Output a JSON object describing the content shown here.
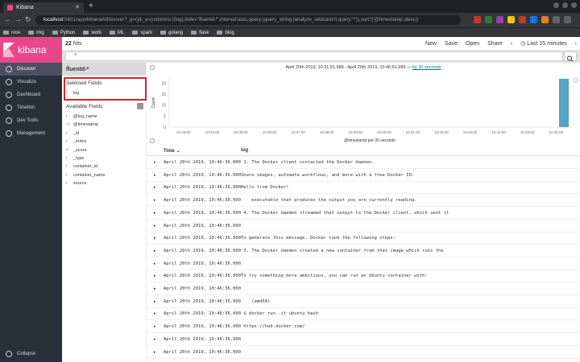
{
  "browser": {
    "tab_title": "Kibana",
    "new_tab": "+",
    "url_host": "localhost",
    "url_rest": ":5601/app/kibana#/discover?_g=()&_a=(columns:!(log),index:'fluentd-*',interval:auto,query:(query_string:(analyze_wildcard:!t,query:'*')),sort:!('@timestamp',desc))",
    "bookmarks": [
      "nice",
      "img",
      "Python",
      "work",
      "ML",
      "spark",
      "golang",
      "flask",
      "blog"
    ],
    "colors": {
      "tabbar": "#202124",
      "toolbar": "#35363a"
    }
  },
  "sidebar": {
    "brand": "kibana",
    "items": [
      {
        "label": "Discover",
        "icon": "compass-icon",
        "active": true
      },
      {
        "label": "Visualize",
        "icon": "bar-chart-icon",
        "active": false
      },
      {
        "label": "Dashboard",
        "icon": "dashboard-icon",
        "active": false
      },
      {
        "label": "Timelion",
        "icon": "timelion-icon",
        "active": false
      },
      {
        "label": "Dev Tools",
        "icon": "wrench-icon",
        "active": false
      },
      {
        "label": "Management",
        "icon": "gear-icon",
        "active": false
      }
    ],
    "collapse_label": "Collapse",
    "colors": {
      "bg": "#2a2f3a",
      "brand": "#e8488b",
      "active": "#4a5161"
    }
  },
  "topbar": {
    "hits_count": "22",
    "hits_label": "hits",
    "menu": [
      "New",
      "Save",
      "Open",
      "Share"
    ],
    "time_label": "Last 15 minutes"
  },
  "query": {
    "value": "*"
  },
  "fields": {
    "index_pattern": "fluentd-*",
    "selected_title": "Selected Fields",
    "selected": [
      {
        "type": "t",
        "name": "log"
      }
    ],
    "available_title": "Available Fields",
    "available": [
      {
        "type": "t",
        "name": "@log_name"
      },
      {
        "type": "◷",
        "name": "@timestamp"
      },
      {
        "type": "t",
        "name": "_id"
      },
      {
        "type": "t",
        "name": "_index"
      },
      {
        "type": "#",
        "name": "_score"
      },
      {
        "type": "t",
        "name": "_type"
      },
      {
        "type": "t",
        "name": "container_id"
      },
      {
        "type": "t",
        "name": "container_name"
      },
      {
        "type": "t",
        "name": "source"
      }
    ]
  },
  "histogram": {
    "range_text": "April 20th 2019, 10:31:51.989 - April 20th 2019, 10:46:51.989 —",
    "interval_link": "by 30 seconds"
  },
  "chart_data": {
    "type": "bar",
    "categories": [
      "10:33:00",
      "10:34:00",
      "10:35:00",
      "10:36:00",
      "10:37:00",
      "10:38:00",
      "10:39:00",
      "10:40:00",
      "10:41:00",
      "10:42:00",
      "10:43:00",
      "10:44:00",
      "10:45:00",
      "10:46:00"
    ],
    "values": [
      0,
      0,
      0,
      0,
      0,
      0,
      0,
      0,
      0,
      0,
      0,
      0,
      0,
      22
    ],
    "ylabel": "Count",
    "xlabel": "@timestamp per 30 seconds",
    "yticks": [
      "0",
      "5",
      "10",
      "15",
      "20"
    ],
    "ylim": [
      0,
      22
    ],
    "bar_color": "#57a3c3"
  },
  "table": {
    "columns": {
      "time": "Time",
      "log": "log"
    },
    "rows": [
      {
        "time": "April 20th 2019, 10:46:36.000",
        "log": " 1. The Docker client contacted the Docker daemon."
      },
      {
        "time": "April 20th 2019, 10:46:36.000",
        "log": "Share images, automate workflows, and more with a free Docker ID:"
      },
      {
        "time": "April 20th 2019, 10:46:36.000",
        "log": "Hello from Docker!"
      },
      {
        "time": "April 20th 2019, 10:46:36.000",
        "log": "    executable that produces the output you are currently reading."
      },
      {
        "time": "April 20th 2019, 10:46:36.000",
        "log": " 4. The Docker daemon streamed that output to the Docker client, which sent it"
      },
      {
        "time": "April 20th 2019, 10:46:36.000",
        "log": ""
      },
      {
        "time": "April 20th 2019, 10:46:36.000",
        "log": "To generate this message, Docker took the following steps:"
      },
      {
        "time": "April 20th 2019, 10:46:36.000",
        "log": " 3. The Docker daemon created a new container from that image which runs the"
      },
      {
        "time": "April 20th 2019, 10:46:36.000",
        "log": ""
      },
      {
        "time": "April 20th 2019, 10:46:36.000",
        "log": "To try something more ambitious, you can run an Ubuntu container with:"
      },
      {
        "time": "April 20th 2019, 10:46:36.000",
        "log": ""
      },
      {
        "time": "April 20th 2019, 10:46:36.000",
        "log": "    (amd64)"
      },
      {
        "time": "April 20th 2019, 10:46:36.000",
        "log": " $ docker run -it ubuntu bash"
      },
      {
        "time": "April 20th 2019, 10:46:36.000",
        "log": " https://hub.docker.com/"
      },
      {
        "time": "April 20th 2019, 10:46:36.000",
        "log": ""
      },
      {
        "time": "April 20th 2019, 10:46:36.000",
        "log": ""
      }
    ]
  }
}
